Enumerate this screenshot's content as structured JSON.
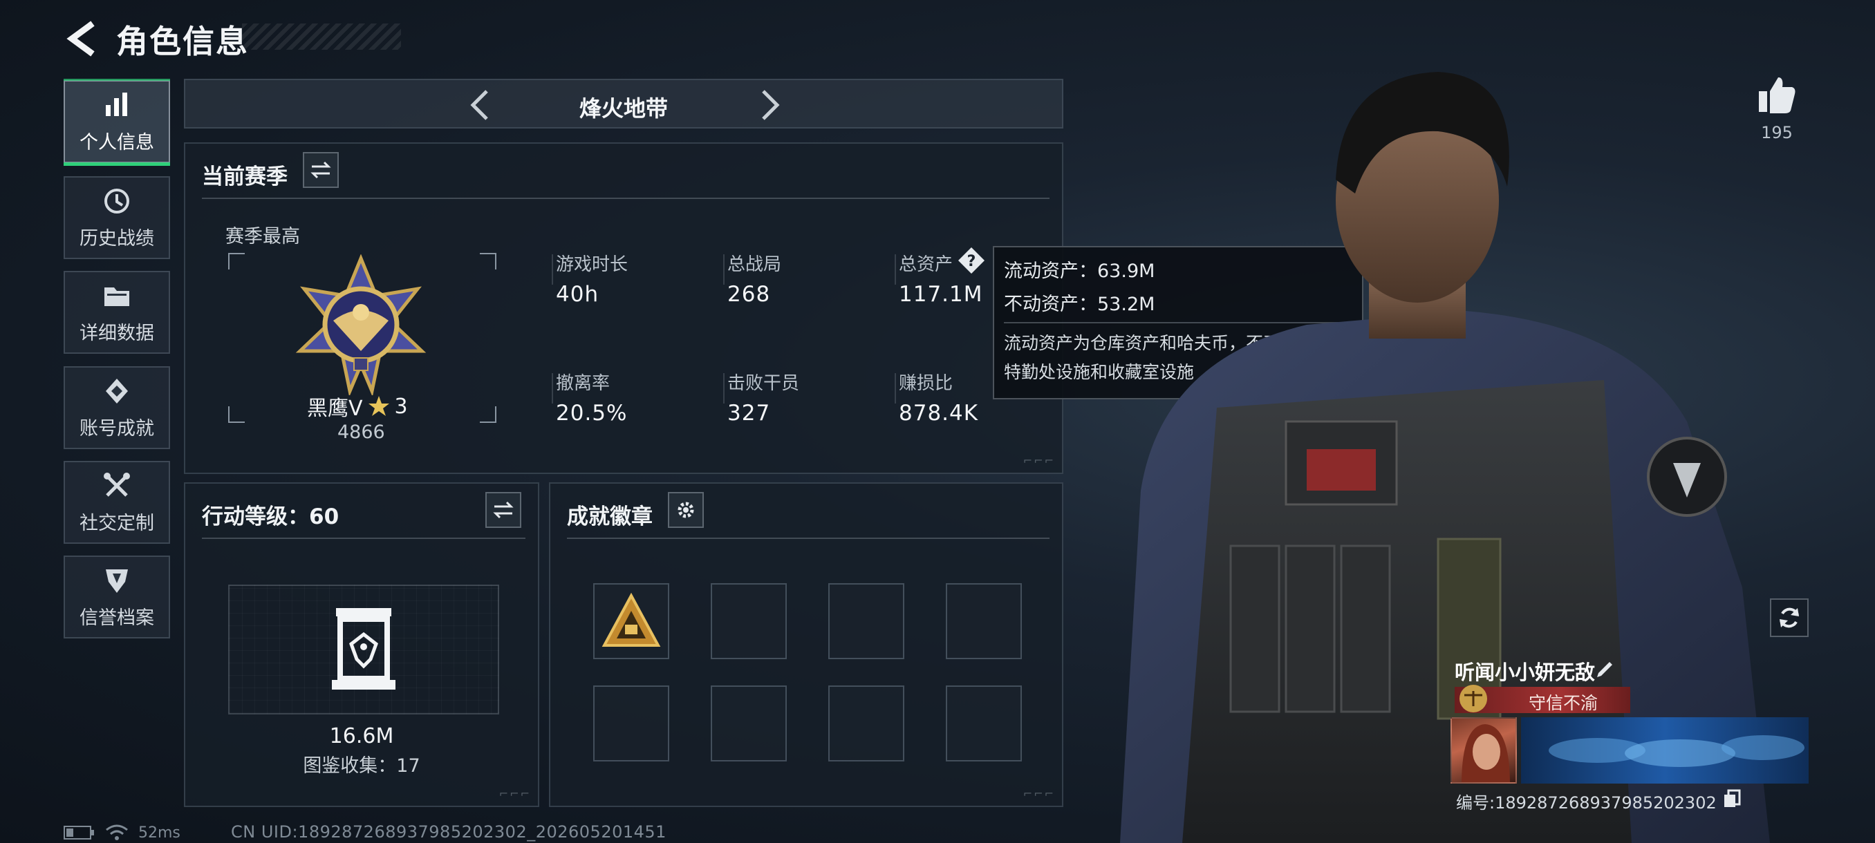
{
  "header": {
    "title": "角色信息"
  },
  "sidebar": {
    "items": [
      {
        "label": "个人信息",
        "icon": "bar-chart-icon",
        "active": true
      },
      {
        "label": "历史战绩",
        "icon": "history-icon",
        "active": false
      },
      {
        "label": "详细数据",
        "icon": "folder-icon",
        "active": false
      },
      {
        "label": "账号成就",
        "icon": "achievement-icon",
        "active": false
      },
      {
        "label": "社交定制",
        "icon": "tools-icon",
        "active": false
      },
      {
        "label": "信誉档案",
        "icon": "shield-icon",
        "active": false
      }
    ]
  },
  "mode": {
    "title": "烽火地带"
  },
  "season": {
    "title": "当前赛季",
    "best_label": "赛季最高",
    "rank_name": "黑鹰Ⅴ",
    "rank_stars": "3",
    "rank_score": "4866",
    "stats": [
      {
        "label": "游戏时长",
        "value": "40h"
      },
      {
        "label": "总战局",
        "value": "268"
      },
      {
        "label": "总资产",
        "value": "117.1M"
      },
      {
        "label": "撤离率",
        "value": "20.5%"
      },
      {
        "label": "击败干员",
        "value": "327"
      },
      {
        "label": "赚损比",
        "value": "878.4K"
      }
    ]
  },
  "tooltip": {
    "liquid": "流动资产：63.9M",
    "fixed": "不动资产：53.2M",
    "desc": "流动资产为仓库资产和哈夫币，不动资产为特勤处设施和收藏室设施"
  },
  "level": {
    "title": "行动等级：60",
    "value": "16.6M",
    "collection": "图鉴收集：17"
  },
  "badges": {
    "title": "成就徽章"
  },
  "profile": {
    "likes": "195",
    "name": "听闻小小妍无敌",
    "honor": "守信不渝",
    "id": "编号:1892872689379852023​02"
  },
  "status": {
    "ping": "52ms",
    "uid": "CN UID:18928726893798520230​2_202605201451"
  },
  "colors": {
    "accent_green": "#2fd07a",
    "honor_red": "#a33232"
  }
}
